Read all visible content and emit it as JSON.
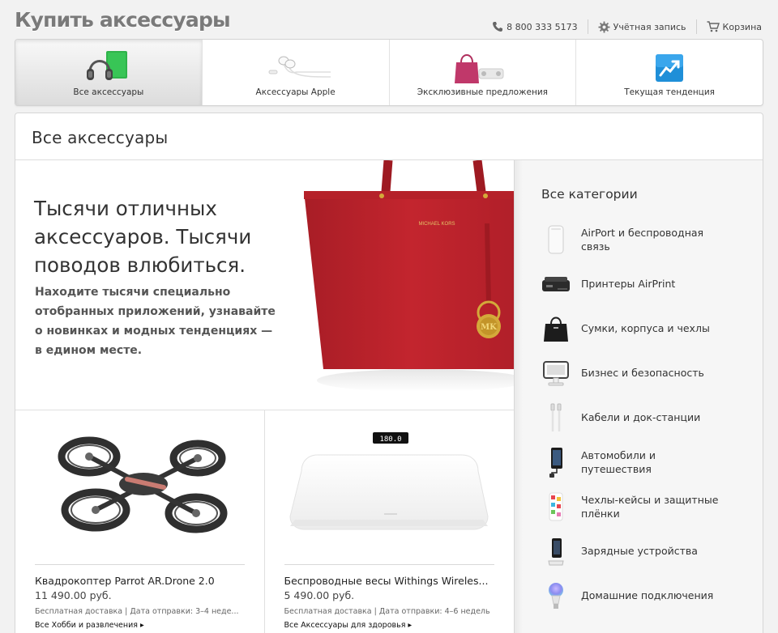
{
  "header": {
    "title": "Купить аксессуары",
    "phone": "8 800 333 5173",
    "account": "Учётная запись",
    "cart": "Корзина"
  },
  "tabs": [
    {
      "label": "Все аксессуары",
      "active": true,
      "icon": "headphones-and-case-icon"
    },
    {
      "label": "Аксессуары Apple",
      "active": false,
      "icon": "earpods-icon"
    },
    {
      "label": "Эксклюзивные предложения",
      "active": false,
      "icon": "pink-bag-icon"
    },
    {
      "label": "Текущая тенденция",
      "active": false,
      "icon": "trend-chart-icon"
    }
  ],
  "main": {
    "title": "Все аксессуары",
    "hero": {
      "headline": "Тысячи отличных аксессуаров. Тысячи поводов влюбиться.",
      "subtext": "Находите тысячи специально отобранных приложений, узнавайте о новинках и модных тенденциях — в едином месте.",
      "bag_brand": "MICHAEL KORS",
      "bag_charm": "MK"
    },
    "products": [
      {
        "name": "Квадрокоптер Parrot AR.Drone 2.0",
        "price": "11 490.00 руб.",
        "shipping": "Бесплатная доставка | Дата отправки: 3–4 неде...",
        "link": "Все Хобби и развлечения ▸",
        "icon": "drone-icon"
      },
      {
        "name": "Беспроводные весы Withings Wireles...",
        "price": "5 490.00 руб.",
        "shipping": "Бесплатная доставка | Дата отправки: 4–6 недель",
        "link": "Все Аксессуары для здоровья ▸",
        "display": "180.0",
        "icon": "scale-icon"
      }
    ]
  },
  "sidebar": {
    "title": "Все категории",
    "categories": [
      {
        "label": "AirPort и беспроводная связь",
        "icon": "airport-icon"
      },
      {
        "label": "Принтеры AirPrint",
        "icon": "printer-icon"
      },
      {
        "label": "Сумки, корпуса и чехлы",
        "icon": "bag-icon"
      },
      {
        "label": "Бизнес и безопасность",
        "icon": "pos-terminal-icon"
      },
      {
        "label": "Кабели и док-станции",
        "icon": "cable-icon"
      },
      {
        "label": "Автомобили и путешествия",
        "icon": "car-charger-icon"
      },
      {
        "label": "Чехлы-кейсы и защитные плёнки",
        "icon": "phone-case-icon"
      },
      {
        "label": "Зарядные устройства",
        "icon": "dock-icon"
      },
      {
        "label": "Домашние подключения",
        "icon": "smart-bulb-icon"
      }
    ]
  },
  "colors": {
    "bag_red": "#c3252e",
    "trend_blue": "#1f8fd8",
    "case_green": "#2fb34a"
  }
}
